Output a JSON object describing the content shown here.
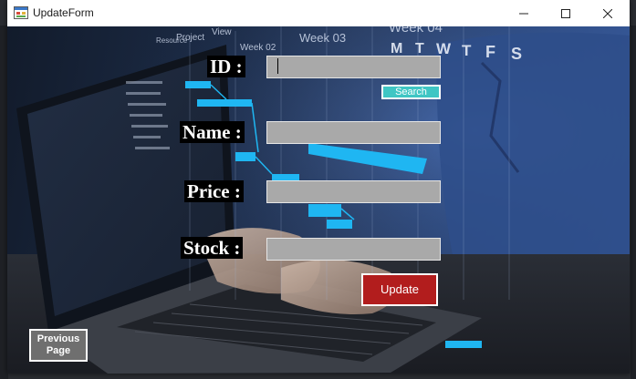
{
  "window": {
    "title": "UpdateForm",
    "app_icon": "form-icon",
    "controls": [
      "minimize-icon",
      "maximize-icon",
      "close-icon"
    ]
  },
  "form": {
    "id_label": "ID :",
    "id_value": "",
    "search_label": "Search",
    "name_label": "Name :",
    "name_value": "",
    "price_label": "Price :",
    "price_value": "",
    "stock_label": "Stock :",
    "stock_value": "",
    "update_label": "Update",
    "previous_label_line1": "Previous",
    "previous_label_line2": "Page"
  },
  "background": {
    "gantt_headers": [
      "Project",
      "View",
      "Week 02",
      "Week 03",
      "Week 04"
    ],
    "gantt_days": [
      "M",
      "T",
      "W",
      "T",
      "F",
      "S"
    ],
    "colors": {
      "bar": "#1fb6f2",
      "search_button": "#3fc6c4",
      "update_button": "#b21d1d",
      "previous_button": "#6f6f6f",
      "field": "#a9a9a9"
    }
  }
}
